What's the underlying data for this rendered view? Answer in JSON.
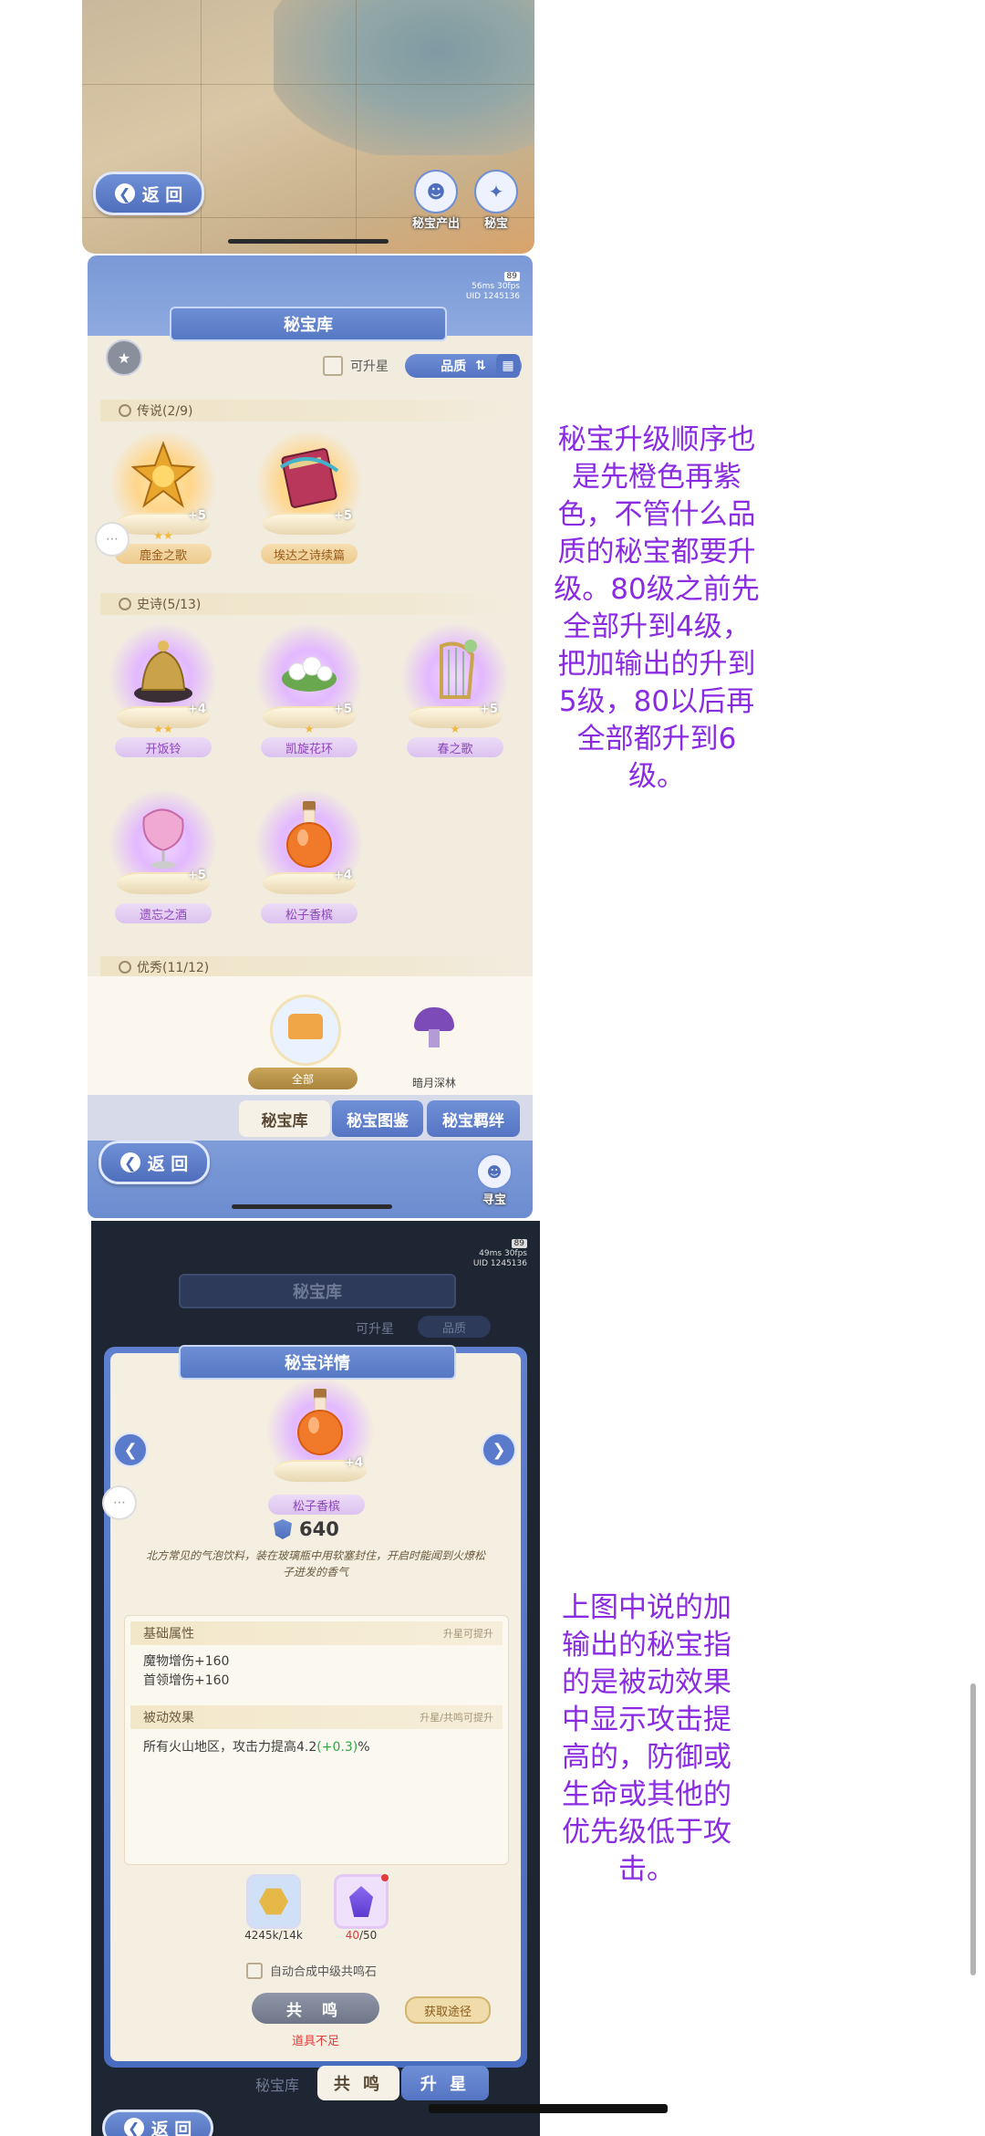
{
  "map_panel": {
    "back_label": "返 回",
    "icons": [
      {
        "icon": "treasure-output-icon",
        "label": "秘宝产出"
      },
      {
        "icon": "treasure-icon",
        "label": "秘宝"
      }
    ]
  },
  "vault": {
    "status": {
      "ping": "56ms",
      "fps": "30fps",
      "uid": "UID 1245136",
      "battery": "89"
    },
    "title": "秘宝库",
    "upgradable_label": "可升星",
    "quality_label": "品质",
    "sections": [
      {
        "label": "传说(2/9)"
      },
      {
        "label": "史诗(5/13)"
      },
      {
        "label": "优秀(11/12)"
      }
    ],
    "legend_items": [
      {
        "name": "鹿金之歌",
        "stars": "★★",
        "plus": "+5"
      },
      {
        "name": "埃达之诗续篇",
        "stars": "",
        "plus": "+5"
      }
    ],
    "epic_items": [
      {
        "name": "开饭铃",
        "stars": "★★",
        "plus": "+4"
      },
      {
        "name": "凯旋花环",
        "stars": "★",
        "plus": "+5"
      },
      {
        "name": "春之歌",
        "stars": "★",
        "plus": "+5"
      },
      {
        "name": "遗忘之酒",
        "stars": "",
        "plus": "+5"
      },
      {
        "name": "松子香槟",
        "stars": "",
        "plus": "+4"
      }
    ],
    "regions": [
      {
        "label": "全部"
      },
      {
        "label": "暗月深林"
      }
    ],
    "tabs": [
      {
        "label": "秘宝库"
      },
      {
        "label": "秘宝图鉴"
      },
      {
        "label": "秘宝羁绊"
      }
    ],
    "back_label": "返 回",
    "seek_label": "寻宝"
  },
  "detail": {
    "status": {
      "ping": "49ms",
      "fps": "30fps",
      "uid": "UID 1245136",
      "battery": "89"
    },
    "bg_title": "秘宝库",
    "bg_upgradable": "可升星",
    "bg_quality": "品质",
    "title": "秘宝详情",
    "item_name": "松子香槟",
    "item_plus": "+4",
    "power": "640",
    "description": "北方常见的气泡饮料，装在玻璃瓶中用软塞封住，开启时能闻到火燎松子迸发的香气",
    "base_attr_label": "基础属性",
    "base_attr_hint": "升星可提升",
    "base_attrs": [
      "魔物增伤+160",
      "首领增伤+160"
    ],
    "passive_label": "被动效果",
    "passive_hint": "升星/共鸣可提升",
    "passive_text_a": "所有火山地区，攻击力提高4.2",
    "passive_text_b": "(+0.3)",
    "passive_text_c": "%",
    "materials": [
      {
        "icon": "gold-coin-icon",
        "have": "4245k",
        "need": "/14k"
      },
      {
        "icon": "purple-crystal-icon",
        "have": "40",
        "need": "/50"
      }
    ],
    "auto_merge_label": "自动合成中级共鸣石",
    "resonate_label": "共 鸣",
    "get_way_label": "获取途径",
    "insufficient_label": "道具不足",
    "bottom_tab": "秘宝库",
    "bottom_resonate": "共 鸣",
    "bottom_star": "升 星",
    "back_label": "返 回"
  },
  "notes": {
    "upgrade_order": "秘宝升级顺序也是先橙色再紫色，不管什么品质的秘宝都要升级。80级之前先全部升到4级，把加输出的升到5级，80以后再全部都升到6级。",
    "output_explain": "上图中说的加输出的秘宝指的是被动效果中显示攻击提高的，防御或生命或其他的优先级低于攻击。"
  },
  "colors": {
    "note": "#8a2be2",
    "accent_blue": "#5575c4",
    "legend_orange": "#f3b73a",
    "epic_purple": "#8b45b8",
    "warn_red": "#e33b3b",
    "bonus_green": "#2fa84a"
  }
}
